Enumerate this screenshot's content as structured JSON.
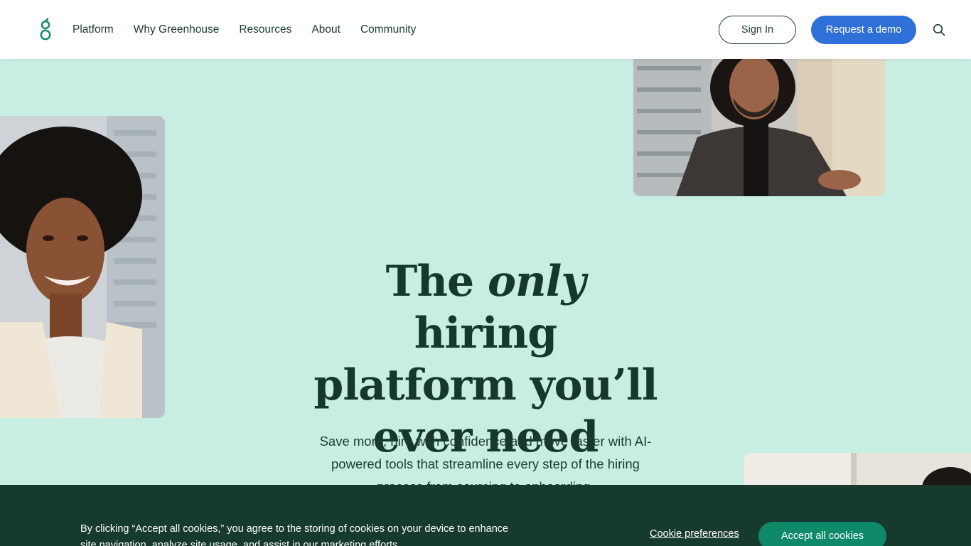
{
  "header": {
    "nav": [
      "Platform",
      "Why Greenhouse",
      "Resources",
      "About",
      "Community"
    ],
    "sign_in": "Sign In",
    "request_demo": "Request a demo"
  },
  "hero": {
    "title_before": "The ",
    "title_emphasis": "only",
    "title_after": " hiring platform you’ll ever need",
    "subtitle": "Save more, hire with confidence and move faster with AI-powered tools that streamline every step of the hiring process from sourcing to onboarding."
  },
  "cookie_banner": {
    "text": "By clicking “Accept all cookies,” you agree to the storing of cookies on your device to enhance site navigation, analyze site usage, and assist in our marketing efforts.",
    "preferences": "Cookie preferences",
    "accept": "Accept all cookies"
  },
  "icons": {
    "logo": "greenhouse-logo-icon",
    "search": "search-icon"
  },
  "colors": {
    "hero_bg": "#c8eee3",
    "primary_button": "#2f6fd8",
    "cookie_bg": "#173a2f",
    "accept_button": "#0e8a68",
    "text_dark": "#15372c",
    "logo_green": "#0e8a68"
  }
}
